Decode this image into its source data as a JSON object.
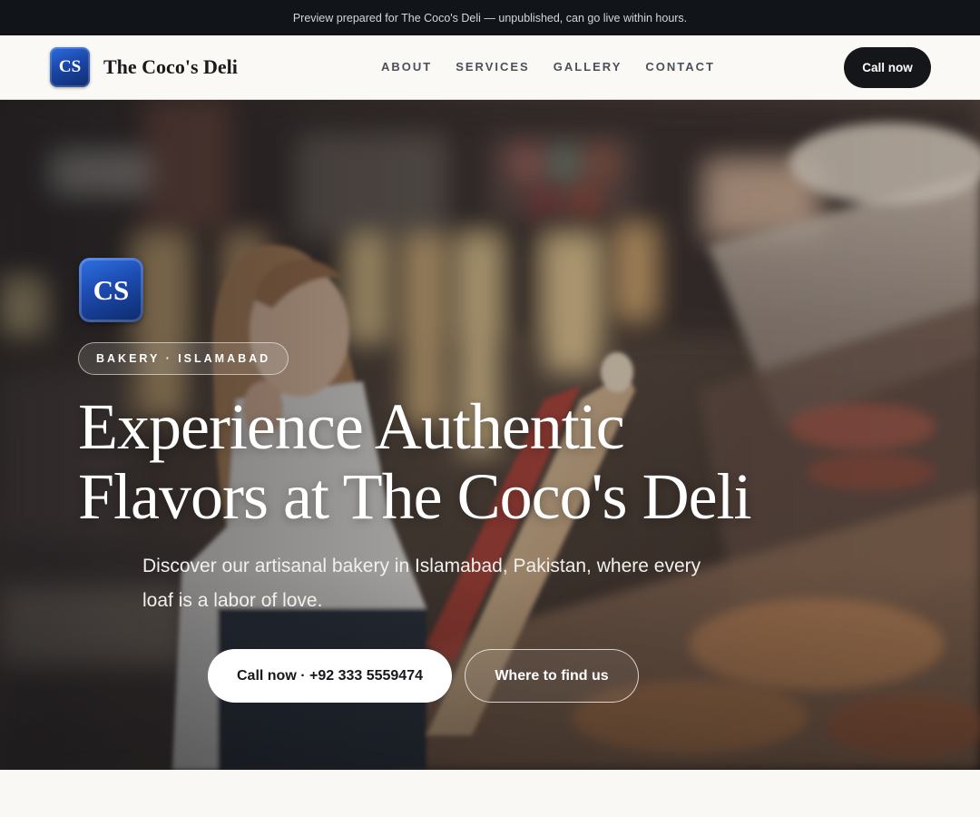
{
  "preview_banner": "Preview prepared for The Coco's Deli — unpublished, can go live within hours.",
  "brand": {
    "initials": "CS",
    "name": "The Coco's Deli"
  },
  "nav": {
    "links": [
      "ABOUT",
      "SERVICES",
      "GALLERY",
      "CONTACT"
    ],
    "cta_label": "Call now"
  },
  "hero": {
    "logo_initials": "CS",
    "tag": "BAKERY · ISLAMABAD",
    "title": "Experience Authentic Flavors at The Coco's Deli",
    "subtitle": "Discover our artisanal bakery in Islamabad, Pakistan, where every loaf is a labor of love.",
    "primary_cta": "Call now · +92 333 5559474",
    "secondary_cta": "Where to find us",
    "background_image": "woman-holding-baguette-in-bakery-photo"
  },
  "colors": {
    "dark": "#111418",
    "brand_blue": "#1b47a8",
    "page_bg": "#f9f8f5"
  }
}
